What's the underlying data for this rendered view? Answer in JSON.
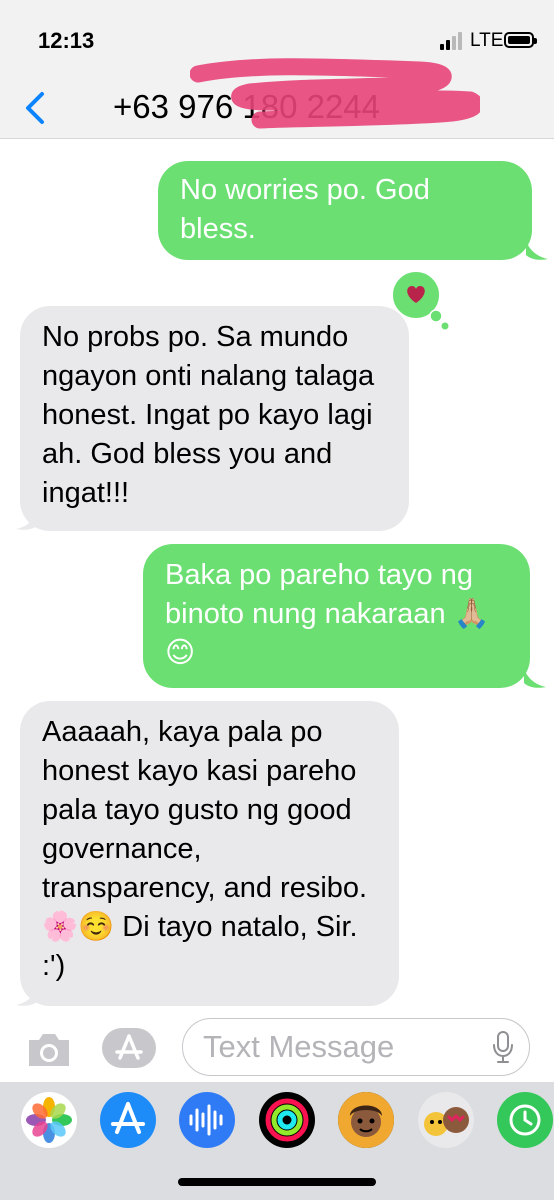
{
  "status": {
    "time": "12:13",
    "network": "LTE"
  },
  "header": {
    "contact": "+63 976 180 2244"
  },
  "messages": [
    {
      "dir": "out",
      "text": "No worries po. God bless."
    },
    {
      "dir": "in",
      "text": "No probs po. Sa mundo ngayon onti nalang talaga honest. Ingat po kayo lagi ah. God bless you and ingat!!!",
      "reaction": "heart"
    },
    {
      "dir": "out",
      "text": "Baka po pareho tayo ng binoto nung nakaraan 🙏🏼😊"
    },
    {
      "dir": "in",
      "text": "Aaaaah, kaya pala po honest kayo kasi pareho pala tayo gusto ng good governance, transparency, and resibo. 🌸☺️ Di tayo natalo, Sir. :')"
    }
  ],
  "composer": {
    "placeholder": "Text Message"
  },
  "app_drawer": [
    "Photos",
    "App Store",
    "Audio",
    "Activity",
    "Memoji",
    "Memoji Stickers",
    "Digital Touch"
  ],
  "colors": {
    "outgoing": "#6cdf73",
    "incoming": "#e9e9eb",
    "accent": "#0a84ff"
  }
}
